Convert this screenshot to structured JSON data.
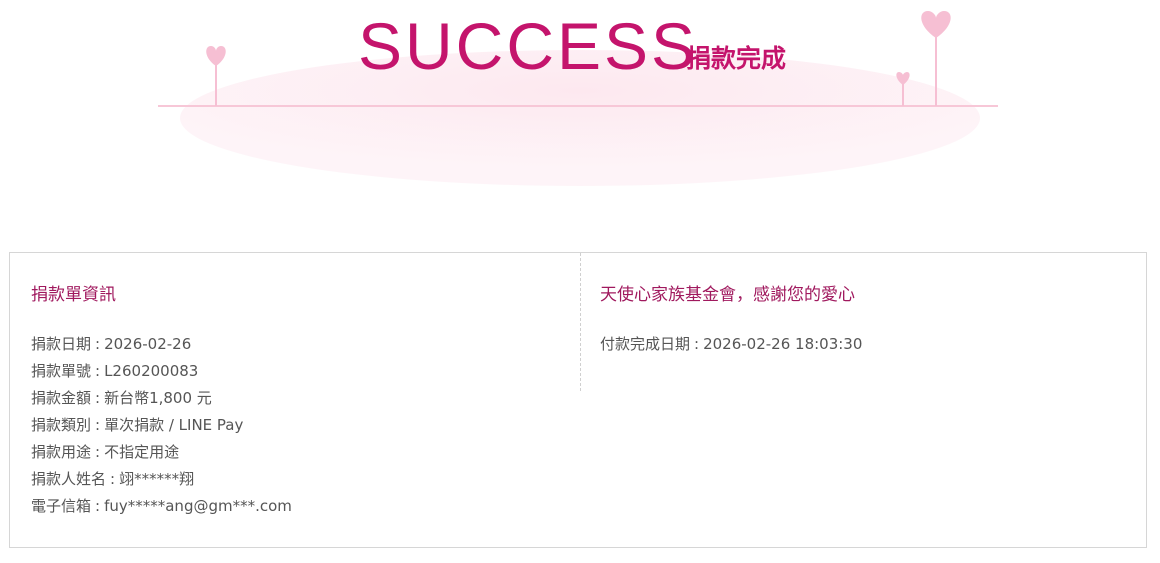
{
  "banner": {
    "title": "SUCCESS",
    "subtitle": "捐款完成",
    "colors": {
      "accent": "#c4146c",
      "heart": "#f6bfd3",
      "line": "#f7c7d7",
      "glow": "#fde8ef"
    }
  },
  "receipt": {
    "title": "捐款單資訊",
    "separator": ":",
    "fields": [
      {
        "label": "捐款日期",
        "value": "2026-02-26"
      },
      {
        "label": "捐款單號",
        "value": "L260200083"
      },
      {
        "label": "捐款金額",
        "value": "新台幣1,800 元"
      },
      {
        "label": "捐款類別",
        "value": "單次捐款 / LINE Pay"
      },
      {
        "label": "捐款用途",
        "value": "不指定用途"
      },
      {
        "label": "捐款人姓名",
        "value": "翊******翔"
      },
      {
        "label": "電子信箱",
        "value": "fuy*****ang@gm***.com"
      }
    ]
  },
  "thanks": {
    "title": "天使心家族基金會，感謝您的愛心",
    "fields": [
      {
        "label": "付款完成日期",
        "value": "2026-02-26 18:03:30"
      }
    ]
  }
}
